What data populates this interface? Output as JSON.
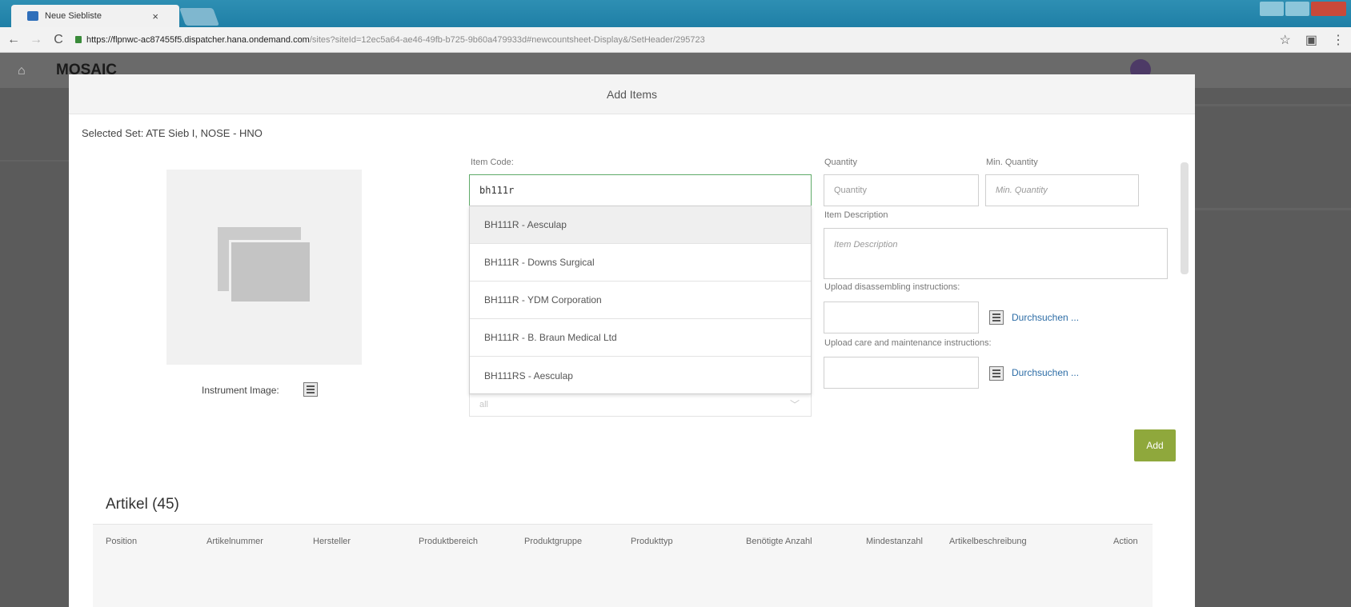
{
  "browser": {
    "tab_title": "Neue Siebliste",
    "tab_close": "×",
    "url_host": "https://flpnwc-ac87455f5.dispatcher.hana.ondemand.com",
    "url_rest": "/sites?siteId=12ec5a64-ae46-49fb-b725-9b60a479933d#newcountsheet-Display&/SetHeader/295723",
    "back_icon": "←",
    "forward_icon": "→",
    "reload_icon": "C",
    "star_icon": "☆",
    "menu_icon": "⋮"
  },
  "app": {
    "title": "MOSAIC",
    "home_icon": "⌂"
  },
  "modal": {
    "header": "Add Items",
    "selected_set": "Selected Set: ATE Sieb I, NOSE - HNO",
    "instrument_image_label": "Instrument Image:",
    "item_code": {
      "label": "Item Code:",
      "value": "bh111r"
    },
    "suggestions": [
      "BH111R - Aesculap",
      "BH111R - Downs Surgical",
      "BH111R - YDM Corporation",
      "BH111R - B. Braun Medical Ltd",
      "BH111RS - Aesculap"
    ],
    "select_behind_value": "all",
    "quantity": {
      "label": "Quantity",
      "placeholder": "Quantity"
    },
    "min_quantity": {
      "label": "Min. Quantity",
      "placeholder": "Min. Quantity"
    },
    "item_description": {
      "label": "Item Description",
      "placeholder": "Item Description"
    },
    "upload_disassembling": {
      "label": "Upload disassembling instructions:",
      "browse": "Durchsuchen ..."
    },
    "upload_care": {
      "label": "Upload care and maintenance instructions:",
      "browse": "Durchsuchen ..."
    },
    "add_button": "Add",
    "articles_title": "Artikel (45)",
    "table_columns": [
      "Position",
      "Artikelnummer",
      "Hersteller",
      "Produktbereich",
      "Produktgruppe",
      "Produkttyp",
      "Benötigte Anzahl",
      "Mindestanzahl",
      "Artikelbeschreibung",
      "Action"
    ]
  }
}
